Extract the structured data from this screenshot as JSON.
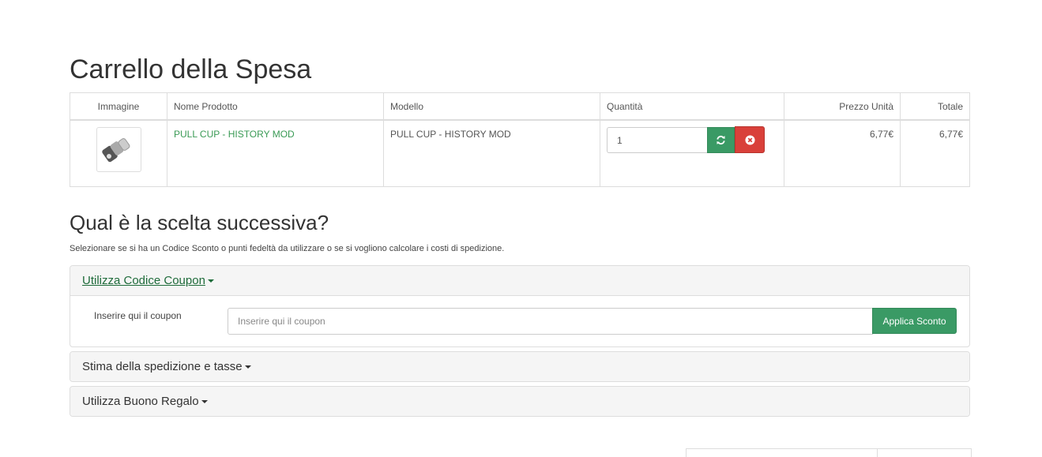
{
  "page": {
    "title": "Carrello della Spesa"
  },
  "cart": {
    "headers": {
      "image": "Immagine",
      "name": "Nome Prodotto",
      "model": "Modello",
      "quantity": "Quantità",
      "unit_price": "Prezzo Unità",
      "total": "Totale"
    },
    "rows": [
      {
        "name": "PULL CUP - HISTORY MOD",
        "model": "PULL CUP - HISTORY MOD",
        "quantity": "1",
        "unit_price": "6,77€",
        "total": "6,77€"
      }
    ]
  },
  "next": {
    "title": "Qual è la scelta successiva?",
    "intro": "Selezionare se si ha un Codice Sconto o punti fedeltà da utilizzare o se si vogliono calcolare i costi di spedizione."
  },
  "panels": {
    "coupon": {
      "title": "Utilizza Codice Coupon",
      "label": "Inserire qui il coupon",
      "placeholder": "Inserire qui il coupon",
      "button": "Applica Sconto"
    },
    "shipping": {
      "title": "Stima della spedizione e tasse"
    },
    "voucher": {
      "title": "Utilizza Buono Regalo"
    }
  },
  "colors": {
    "accent_green": "#3a9a65",
    "danger_red": "#d9403a",
    "link_green": "#1e6b3a"
  },
  "icons": {
    "refresh": "refresh-icon",
    "remove": "remove-circle-icon",
    "caret": "caret-down-icon"
  }
}
